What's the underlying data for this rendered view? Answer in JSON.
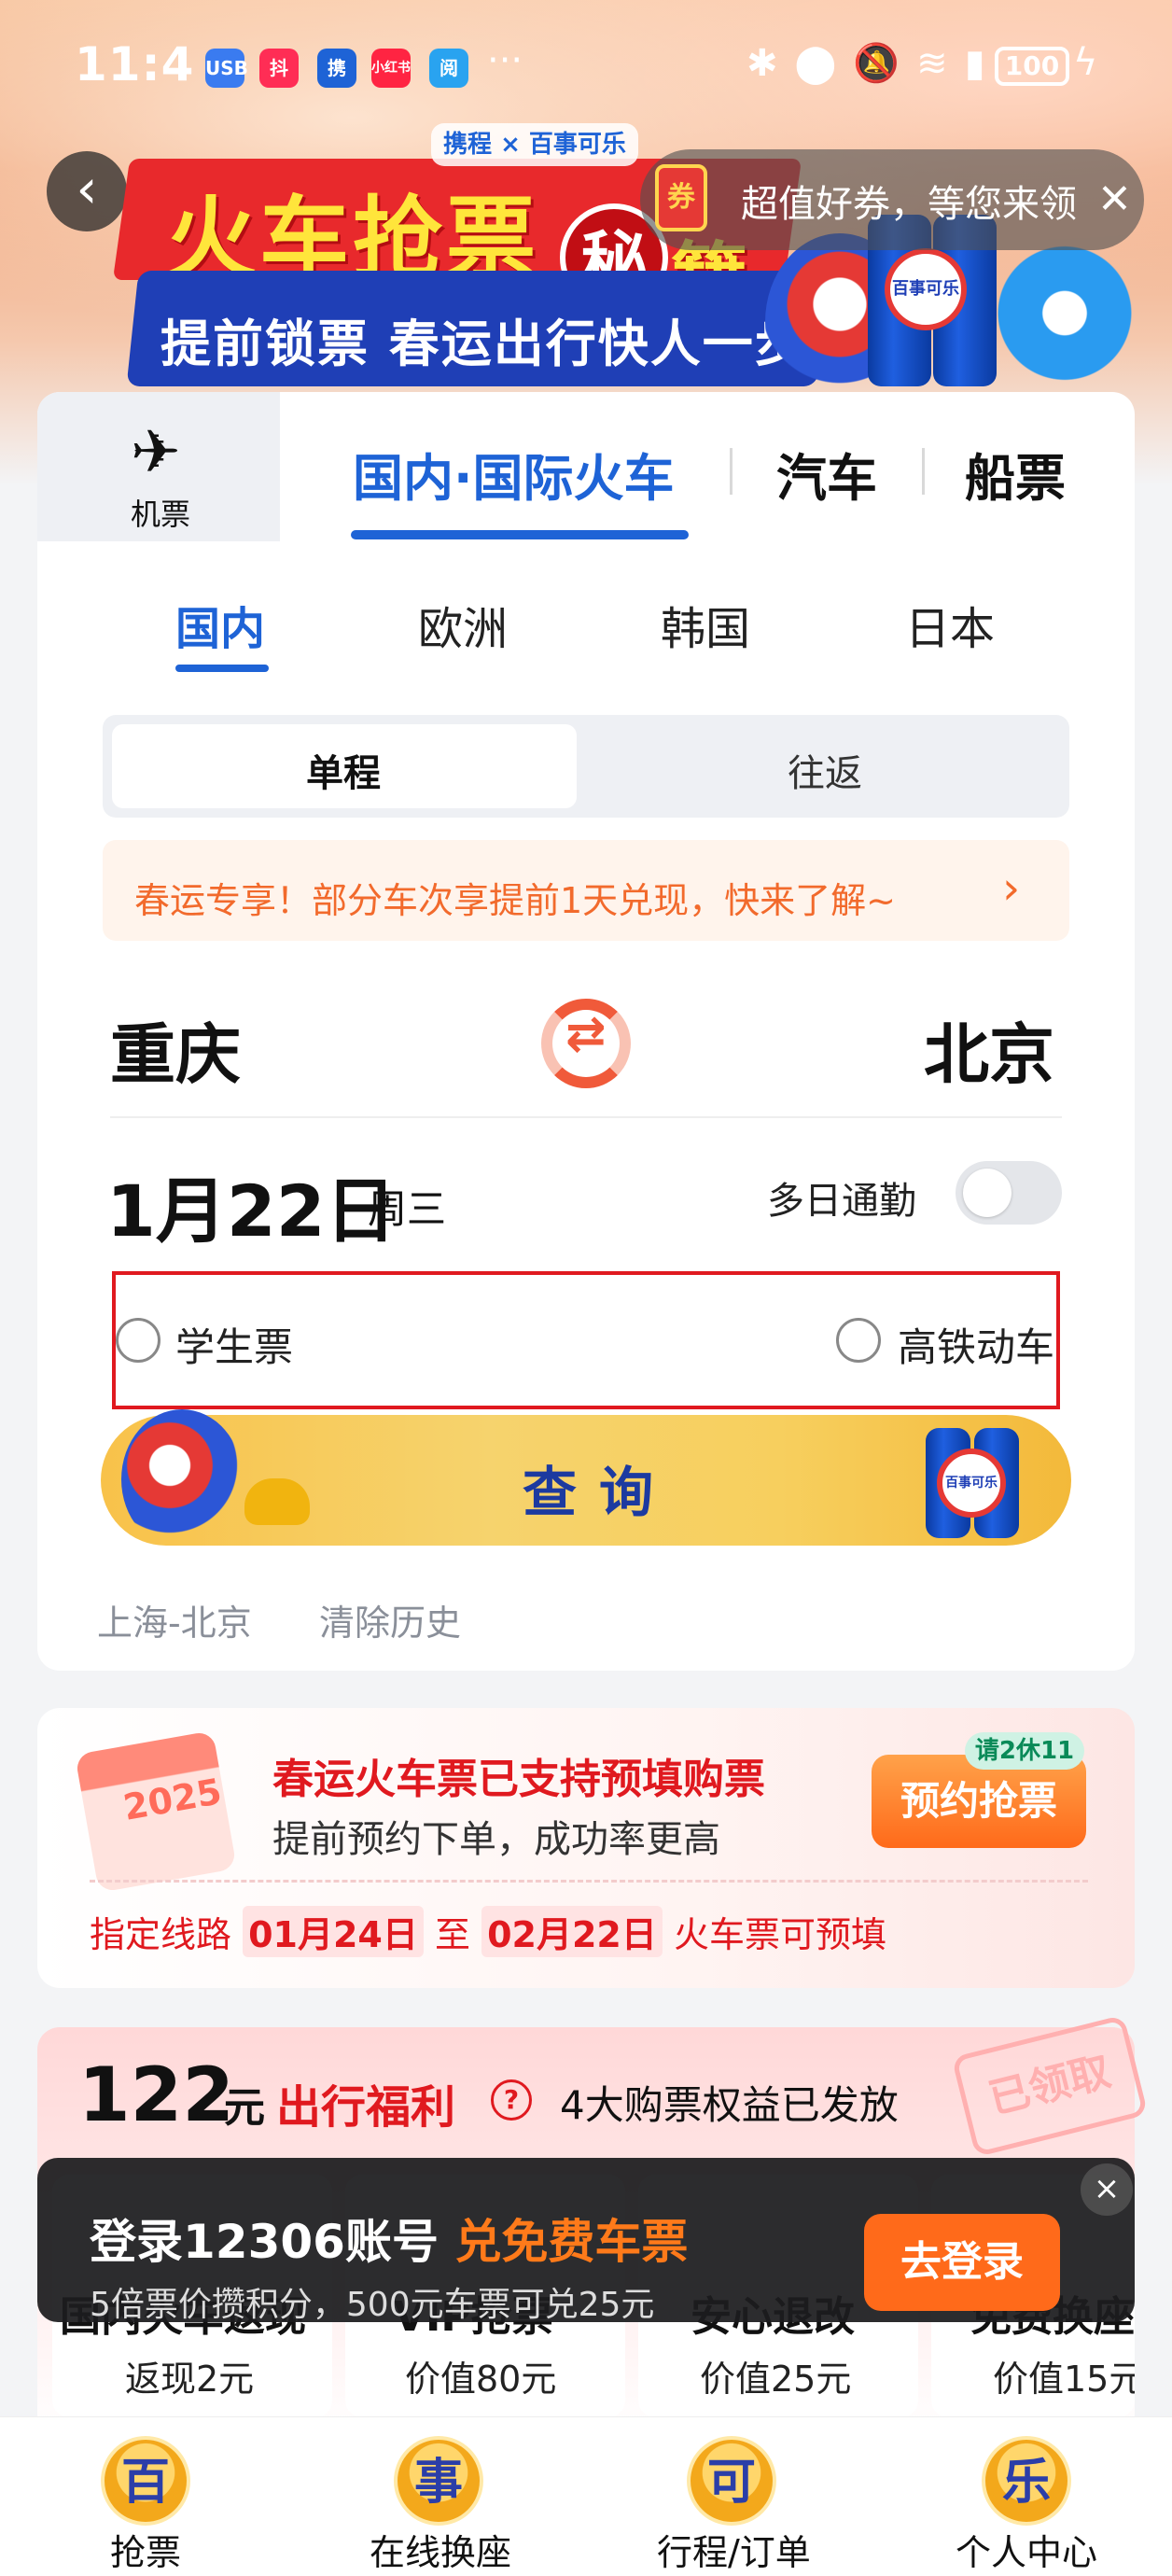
{
  "status_bar": {
    "time": "11:4",
    "more": "···",
    "battery": "100",
    "apps": [
      "USB",
      "抖",
      "携",
      "小红书",
      "阅"
    ],
    "icons": [
      "bluetooth-icon",
      "location-icon",
      "mute-icon",
      "wifi-icon",
      "sim-icon",
      "charging-icon"
    ]
  },
  "hero": {
    "brand": "携程 × 百事可乐",
    "title": "火车抢票",
    "title_circle": "秘",
    "title_tail": "籍",
    "subtitle": "提前锁票 春运出行快人一步",
    "coupon_icon": "券",
    "coupon_text": "超值好券，等您来领",
    "pepsi_label": "百事可乐"
  },
  "mode_tabs": {
    "flight_label": "机票",
    "train_label": "国内·国际火车",
    "bus_label": "汽车",
    "ship_label": "船票"
  },
  "region_tabs": [
    "国内",
    "欧洲",
    "韩国",
    "日本"
  ],
  "trip_type": {
    "one_way": "单程",
    "round_trip": "往返",
    "selected": "单程"
  },
  "promo": {
    "text": "春运专享！部分车次享提前1天兑现，快来了解~"
  },
  "route": {
    "from": "重庆",
    "to": "北京"
  },
  "date": {
    "date": "1月22日",
    "weekday": "周三",
    "commute_label": "多日通勤",
    "commute_on": false
  },
  "options": {
    "student": "学生票",
    "high_speed": "高铁动车"
  },
  "search": {
    "label": "查询"
  },
  "history": {
    "items": [
      "上海-北京"
    ],
    "clear": "清除历史"
  },
  "prebook": {
    "title_red": "春运火车票",
    "title_black": "已支持预填购票",
    "subtitle": "提前预约下单，成功率更高",
    "badge": "请2休11",
    "button": "预约抢票",
    "calendar_year": "2025",
    "route_prefix": "指定线路",
    "date_from": "01月24日",
    "to_word": "至",
    "date_to": "02月22日",
    "route_suffix": "火车票可预填"
  },
  "benefits": {
    "amount": "122",
    "unit": "元",
    "title": "出行福利",
    "help": "?",
    "desc": "4大购票权益已发放",
    "stamp": "已领取",
    "items": [
      {
        "name": "国内火车返现",
        "value": "返现2元"
      },
      {
        "name": "VIP抢票",
        "value": "价值80元"
      },
      {
        "name": "安心退改",
        "value": "价值25元"
      },
      {
        "name": "免费换座",
        "value": "价值15元"
      }
    ]
  },
  "toast": {
    "title": "登录12306账号",
    "title_highlight": "兑免费车票",
    "subtitle": "5倍票价攒积分，500元车票可兑25元",
    "button": "去登录",
    "close": "×"
  },
  "bottom_nav": [
    {
      "icon_char": "百",
      "label": "抢票"
    },
    {
      "icon_char": "事",
      "label": "在线换座"
    },
    {
      "icon_char": "可",
      "label": "行程/订单"
    },
    {
      "icon_char": "乐",
      "label": "个人中心"
    }
  ]
}
